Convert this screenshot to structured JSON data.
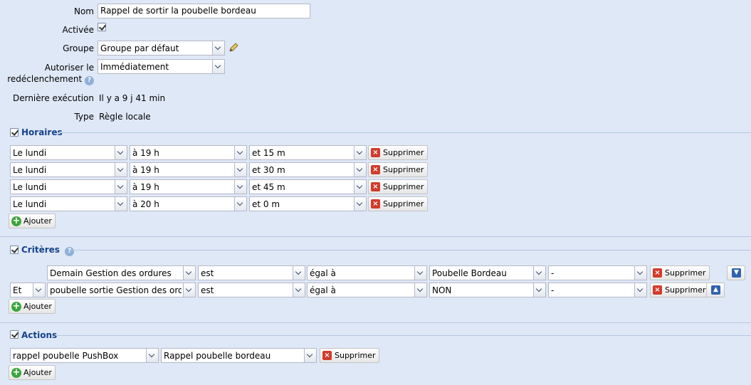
{
  "form": {
    "name_label": "Nom",
    "name_value": "Rappel de sortir la poubelle bordeau",
    "active_label": "Activée",
    "active_checked": true,
    "group_label": "Groupe",
    "group_value": "Groupe par défaut",
    "retrigger_label_1": "Autoriser le",
    "retrigger_label_2": "redéclenchement",
    "retrigger_value": "Immédiatement",
    "last_exec_label": "Dernière exécution",
    "last_exec_value": "Il y a 9 j 41 min",
    "type_label": "Type",
    "type_value": "Règle locale"
  },
  "horaires": {
    "title": "Horaires",
    "enabled": true,
    "rows": [
      {
        "day": "Le lundi",
        "hour": "à 19 h",
        "minute": "et 15 m"
      },
      {
        "day": "Le lundi",
        "hour": "à 19 h",
        "minute": "et 30 m"
      },
      {
        "day": "Le lundi",
        "hour": "à 19 h",
        "minute": "et 45 m"
      },
      {
        "day": "Le lundi",
        "hour": "à 20 h",
        "minute": "et 0 m"
      }
    ],
    "delete_label": "Supprimer",
    "add_label": "Ajouter"
  },
  "criteres": {
    "title": "Critères",
    "enabled": true,
    "rows": [
      {
        "logic": "",
        "subject": "Demain Gestion des ordures",
        "verb": "est",
        "operator": "égal à",
        "value": "Poubelle Bordeau",
        "extra": "-",
        "arrow": "down"
      },
      {
        "logic": "Et",
        "subject": "poubelle sortie Gestion des ordures",
        "verb": "est",
        "operator": "égal à",
        "value": "NON",
        "extra": "-",
        "arrow": "up"
      }
    ],
    "delete_label": "Supprimer",
    "add_label": "Ajouter"
  },
  "actions": {
    "title": "Actions",
    "enabled": true,
    "rows": [
      {
        "device": "rappel poubelle PushBox",
        "message": "Rappel poubelle bordeau"
      }
    ],
    "delete_label": "Supprimer",
    "add_label": "Ajouter"
  }
}
